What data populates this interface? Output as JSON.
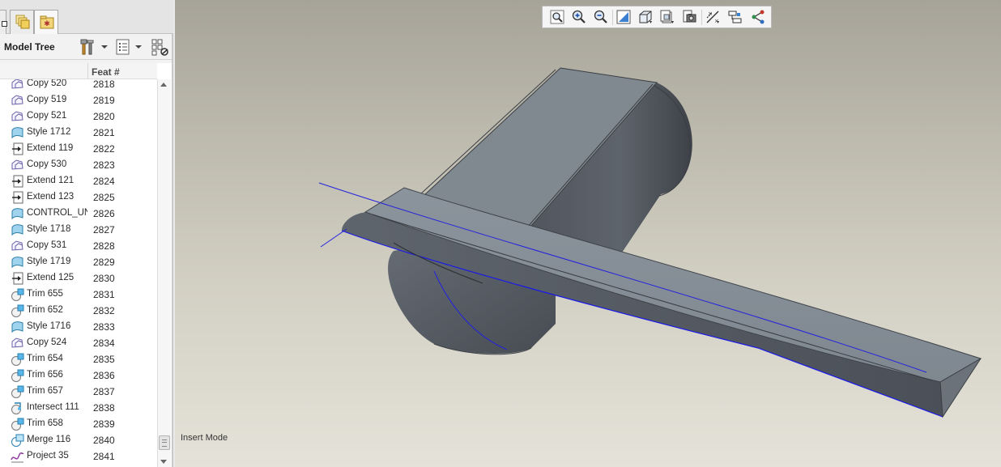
{
  "model_tree": {
    "title": "Model Tree",
    "column_feat": "Feat #",
    "rows": [
      {
        "name": "Copy 520",
        "feat": "2818",
        "icon": "copy-icon"
      },
      {
        "name": "Copy 519",
        "feat": "2819",
        "icon": "copy-icon"
      },
      {
        "name": "Copy 521",
        "feat": "2820",
        "icon": "copy-icon"
      },
      {
        "name": "Style 1712",
        "feat": "2821",
        "icon": "style-icon"
      },
      {
        "name": "Extend 119",
        "feat": "2822",
        "icon": "extend-icon"
      },
      {
        "name": "Copy 530",
        "feat": "2823",
        "icon": "copy-icon"
      },
      {
        "name": "Extend 121",
        "feat": "2824",
        "icon": "extend-icon"
      },
      {
        "name": "Extend 123",
        "feat": "2825",
        "icon": "extend-icon"
      },
      {
        "name": "CONTROL_UNDER",
        "feat": "2826",
        "icon": "style-icon"
      },
      {
        "name": "Style 1718",
        "feat": "2827",
        "icon": "style-icon"
      },
      {
        "name": "Copy 531",
        "feat": "2828",
        "icon": "copy-icon"
      },
      {
        "name": "Style 1719",
        "feat": "2829",
        "icon": "style-icon"
      },
      {
        "name": "Extend 125",
        "feat": "2830",
        "icon": "extend-icon"
      },
      {
        "name": "Trim 655",
        "feat": "2831",
        "icon": "trim-icon"
      },
      {
        "name": "Trim 652",
        "feat": "2832",
        "icon": "trim-icon"
      },
      {
        "name": "Style 1716",
        "feat": "2833",
        "icon": "style-icon"
      },
      {
        "name": "Copy 524",
        "feat": "2834",
        "icon": "copy-icon"
      },
      {
        "name": "Trim 654",
        "feat": "2835",
        "icon": "trim-icon"
      },
      {
        "name": "Trim 656",
        "feat": "2836",
        "icon": "trim-icon"
      },
      {
        "name": "Trim 657",
        "feat": "2837",
        "icon": "trim-icon"
      },
      {
        "name": "Intersect 111",
        "feat": "2838",
        "icon": "intersect-icon"
      },
      {
        "name": "Trim 658",
        "feat": "2839",
        "icon": "trim-icon"
      },
      {
        "name": "Merge 116",
        "feat": "2840",
        "icon": "merge-icon"
      },
      {
        "name": "Project 35",
        "feat": "2841",
        "icon": "project-icon"
      }
    ]
  },
  "view_toolbar": {
    "buttons": [
      "refit-icon",
      "zoom-in-icon",
      "zoom-out-icon",
      "repaint-icon",
      "saved-orientations-icon",
      "named-views-icon",
      "display-style-icon",
      "datum-display-icon",
      "spin-center-icon",
      "annotation-display-icon"
    ]
  },
  "status": {
    "mode": "Insert Mode"
  },
  "colors": {
    "surface_top": "#8a9199",
    "surface_side": "#5d636b",
    "curve_blue": "#1a1ae6",
    "background_top": "#a6a398",
    "background_bottom": "#e5e3d9"
  }
}
